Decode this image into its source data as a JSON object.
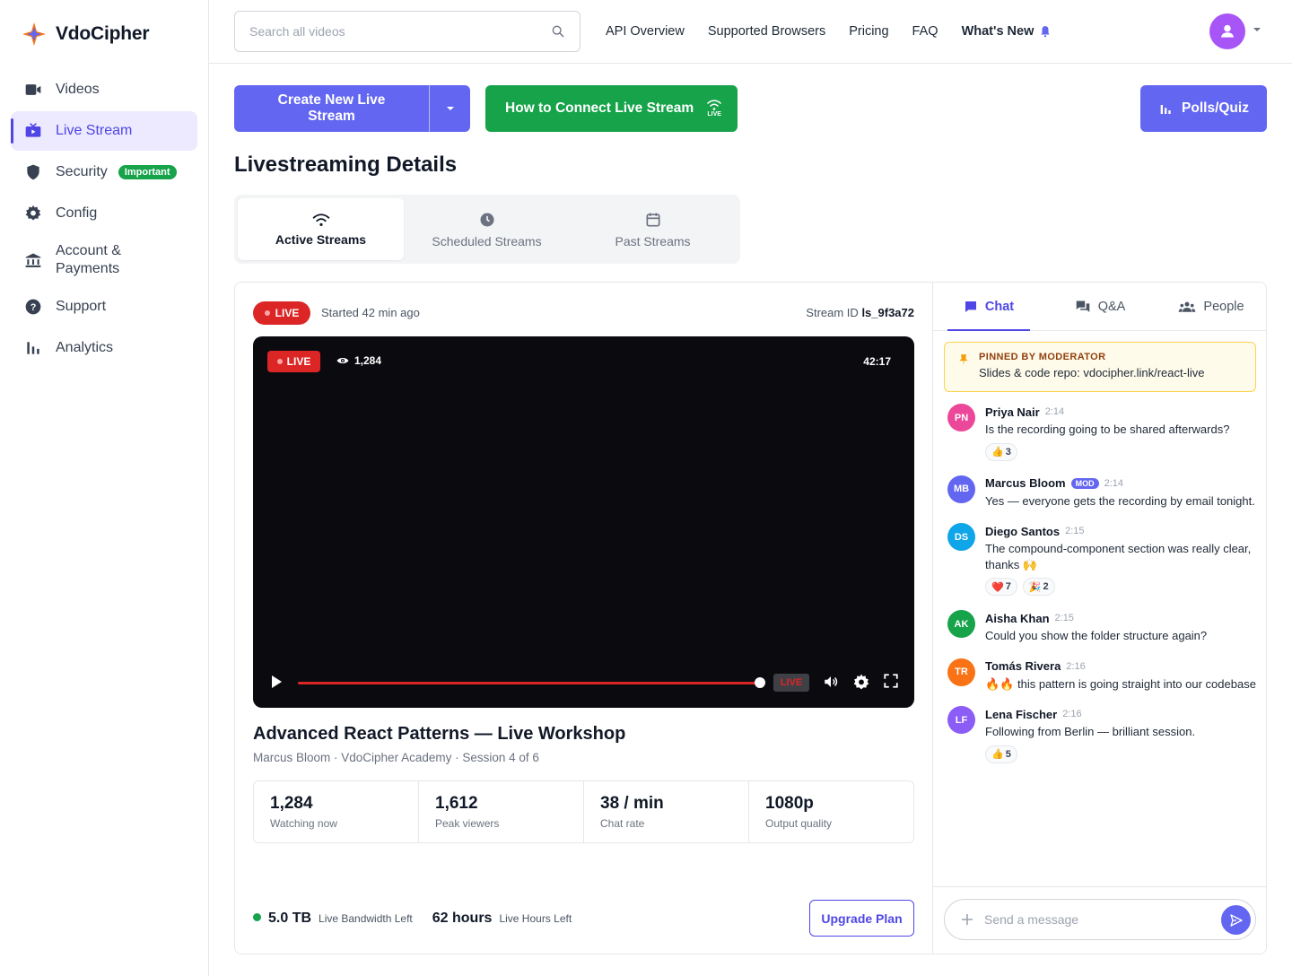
{
  "app": {
    "name": "VdoCipher"
  },
  "sidebar": {
    "items": [
      {
        "label": "Videos",
        "icon": "video-camera-icon"
      },
      {
        "label": "Live Stream",
        "icon": "live-tv-icon",
        "active": true
      },
      {
        "label": "Security",
        "icon": "shield-icon",
        "badge": "Important"
      },
      {
        "label": "Config",
        "icon": "gear-icon"
      },
      {
        "label": "Account & Payments",
        "line1": "Account &",
        "line2": "Payments",
        "icon": "bank-icon"
      },
      {
        "label": "Support",
        "icon": "help-icon"
      },
      {
        "label": "Analytics",
        "icon": "bar-chart-icon"
      }
    ]
  },
  "topbar": {
    "search_placeholder": "Search all videos",
    "links": [
      "API Overview",
      "Supported Browsers",
      "Pricing",
      "FAQ"
    ],
    "whats_new": "What's New"
  },
  "actions": {
    "create": "Create New Live Stream",
    "connect": "How to Connect Live Stream",
    "connect_badge": "LIVE",
    "polls": "Polls/Quiz"
  },
  "page": {
    "title": "Livestreaming Details"
  },
  "tabs": [
    {
      "label": "Active Streams",
      "active": true
    },
    {
      "label": "Scheduled Streams"
    },
    {
      "label": "Past Streams"
    }
  ],
  "stream": {
    "live_label": "LIVE",
    "started": "Started 42 min ago",
    "id_label": "Stream ID",
    "id_value": "ls_9f3a72",
    "viewers": "1,284",
    "elapsed": "42:17",
    "progress": 1.0,
    "title": "Advanced React Patterns — Live Workshop",
    "subtitle": "Marcus Bloom · VdoCipher Academy · Session 4 of 6",
    "stats": [
      {
        "value": "1,284",
        "label": "Watching now"
      },
      {
        "value": "1,612",
        "label": "Peak viewers"
      },
      {
        "value": "38 / min",
        "label": "Chat rate"
      },
      {
        "value": "1080p",
        "label": "Output quality"
      }
    ],
    "bandwidth_value": "5.0 TB",
    "bandwidth_label": "Live Bandwidth Left",
    "hours_value": "62 hours",
    "hours_label": "Live Hours Left",
    "upgrade": "Upgrade Plan"
  },
  "chat": {
    "tabs": [
      {
        "label": "Chat",
        "active": true
      },
      {
        "label": "Q&A"
      },
      {
        "label": "People"
      }
    ],
    "pinned_header": "PINNED BY MODERATOR",
    "pinned_text": "Slides & code repo: vdocipher.link/react-live",
    "messages": [
      {
        "initials": "PN",
        "color": "#ec4899",
        "name": "Priya Nair",
        "time": "2:14",
        "text": "Is the recording going to be shared afterwards?",
        "reactions": [
          {
            "emoji": "👍",
            "count": "3"
          }
        ]
      },
      {
        "initials": "MB",
        "color": "#6366f1",
        "name": "Marcus Bloom",
        "badge": "MOD",
        "time": "2:14",
        "text": "Yes — everyone gets the recording by email tonight."
      },
      {
        "initials": "DS",
        "color": "#0ea5e9",
        "name": "Diego Santos",
        "time": "2:15",
        "text": "The compound-component section was really clear, thanks 🙌",
        "reactions": [
          {
            "emoji": "❤️",
            "count": "7"
          },
          {
            "emoji": "🎉",
            "count": "2"
          }
        ]
      },
      {
        "initials": "AK",
        "color": "#16a34a",
        "name": "Aisha Khan",
        "time": "2:15",
        "text": "Could you show the folder structure again?"
      },
      {
        "initials": "TR",
        "color": "#f97316",
        "name": "Tomás Rivera",
        "time": "2:16",
        "text": "🔥🔥 this pattern is going straight into our codebase"
      },
      {
        "initials": "LF",
        "color": "#8b5cf6",
        "name": "Lena Fischer",
        "time": "2:16",
        "text": "Following from Berlin — brilliant session.",
        "reactions": [
          {
            "emoji": "👍",
            "count": "5"
          }
        ]
      }
    ],
    "input_placeholder": "Send a message"
  },
  "colors": {
    "primary": "#6366f1",
    "green": "#16a34a",
    "live": "#dc2626"
  }
}
